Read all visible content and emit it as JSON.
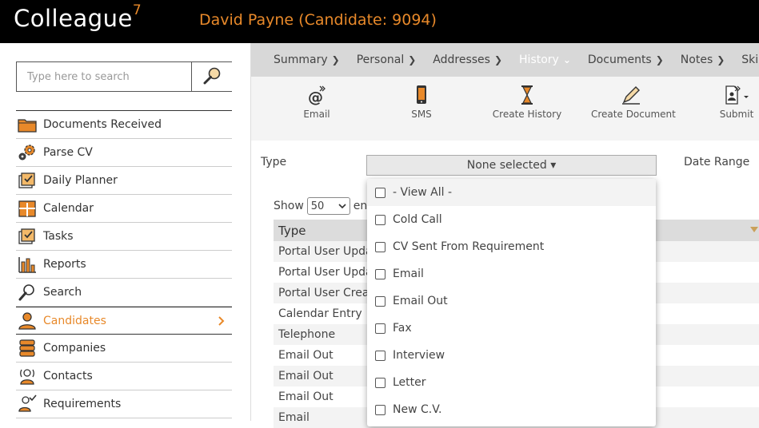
{
  "header": {
    "logo_text": "Colleague",
    "logo_sup": "7",
    "title": "David Payne (Candidate: 9094)"
  },
  "search": {
    "placeholder": "Type here to search"
  },
  "sidebar": {
    "items": [
      {
        "label": "Documents Received",
        "icon": "folder-icon"
      },
      {
        "label": "Parse CV",
        "icon": "gears-icon"
      },
      {
        "label": "Daily Planner",
        "icon": "planner-icon"
      },
      {
        "label": "Calendar",
        "icon": "calendar-icon"
      },
      {
        "label": "Tasks",
        "icon": "tasks-icon"
      },
      {
        "label": "Reports",
        "icon": "reports-icon"
      },
      {
        "label": "Search",
        "icon": "magnifier-icon"
      },
      {
        "label": "Candidates",
        "icon": "person-icon",
        "active": true
      },
      {
        "label": "Companies",
        "icon": "companies-icon"
      },
      {
        "label": "Contacts",
        "icon": "contacts-icon"
      },
      {
        "label": "Requirements",
        "icon": "requirements-icon"
      }
    ]
  },
  "tabs": [
    {
      "label": "Summary",
      "chev": "❯"
    },
    {
      "label": "Personal",
      "chev": "❯"
    },
    {
      "label": "Addresses",
      "chev": "❯"
    },
    {
      "label": "History",
      "chev": "⌄",
      "active": true
    },
    {
      "label": "Documents",
      "chev": "❯"
    },
    {
      "label": "Notes",
      "chev": "❯"
    },
    {
      "label": "Skil",
      "chev": ""
    }
  ],
  "toolbar": {
    "email": "Email",
    "sms": "SMS",
    "create_history": "Create History",
    "create_document": "Create Document",
    "submit": "Submit"
  },
  "filters": {
    "type_label": "Type",
    "type_value": "None selected",
    "date_range_label": "Date Range"
  },
  "table": {
    "show_label": "Show",
    "show_value": "50",
    "entries_label": "entries",
    "column_type": "Type",
    "rows": [
      "Portal User Update",
      "Portal User Update",
      "Portal User Created",
      "Calendar Entry",
      "Telephone",
      "Email Out",
      "Email Out",
      "Email Out",
      "Email"
    ]
  },
  "dropdown": {
    "options": [
      "- View All -",
      "Cold Call",
      "CV Sent From Requirement",
      "Email",
      "Email Out",
      "Fax",
      "Interview",
      "Letter",
      "New C.V."
    ]
  },
  "colors": {
    "accent": "#e8892a",
    "topbar": "#000000",
    "tabbar": "#d8d8d8"
  }
}
